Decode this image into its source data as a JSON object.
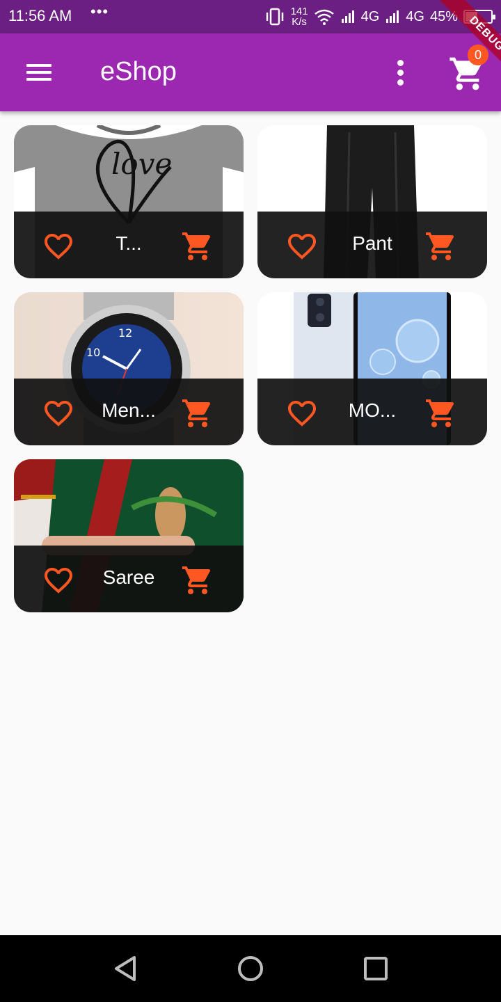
{
  "status_bar": {
    "time": "11:56 AM",
    "dots": "•••",
    "speed_value": "141",
    "speed_unit": "K/s",
    "net1": "4G",
    "net2": "4G",
    "battery": "45%",
    "battery_level": 0.45
  },
  "app_bar": {
    "title": "eShop",
    "cart_count": "0",
    "debug_label": "DEBUG"
  },
  "products": [
    {
      "name": "T...",
      "image_icon": "tshirt-image"
    },
    {
      "name": "Pant",
      "image_icon": "pant-image"
    },
    {
      "name": "Men...",
      "image_icon": "watch-image"
    },
    {
      "name": "MO...",
      "image_icon": "phone-image"
    },
    {
      "name": "Saree",
      "image_icon": "saree-image"
    }
  ],
  "colors": {
    "status_bar": "#6c1f82",
    "app_bar": "#9c27b0",
    "accent": "#ff5722",
    "card_bar": "#101010",
    "background": "#fafafa"
  },
  "nav": {
    "back_icon": "back-triangle-icon",
    "home_icon": "home-circle-icon",
    "recents_icon": "recents-square-icon"
  }
}
